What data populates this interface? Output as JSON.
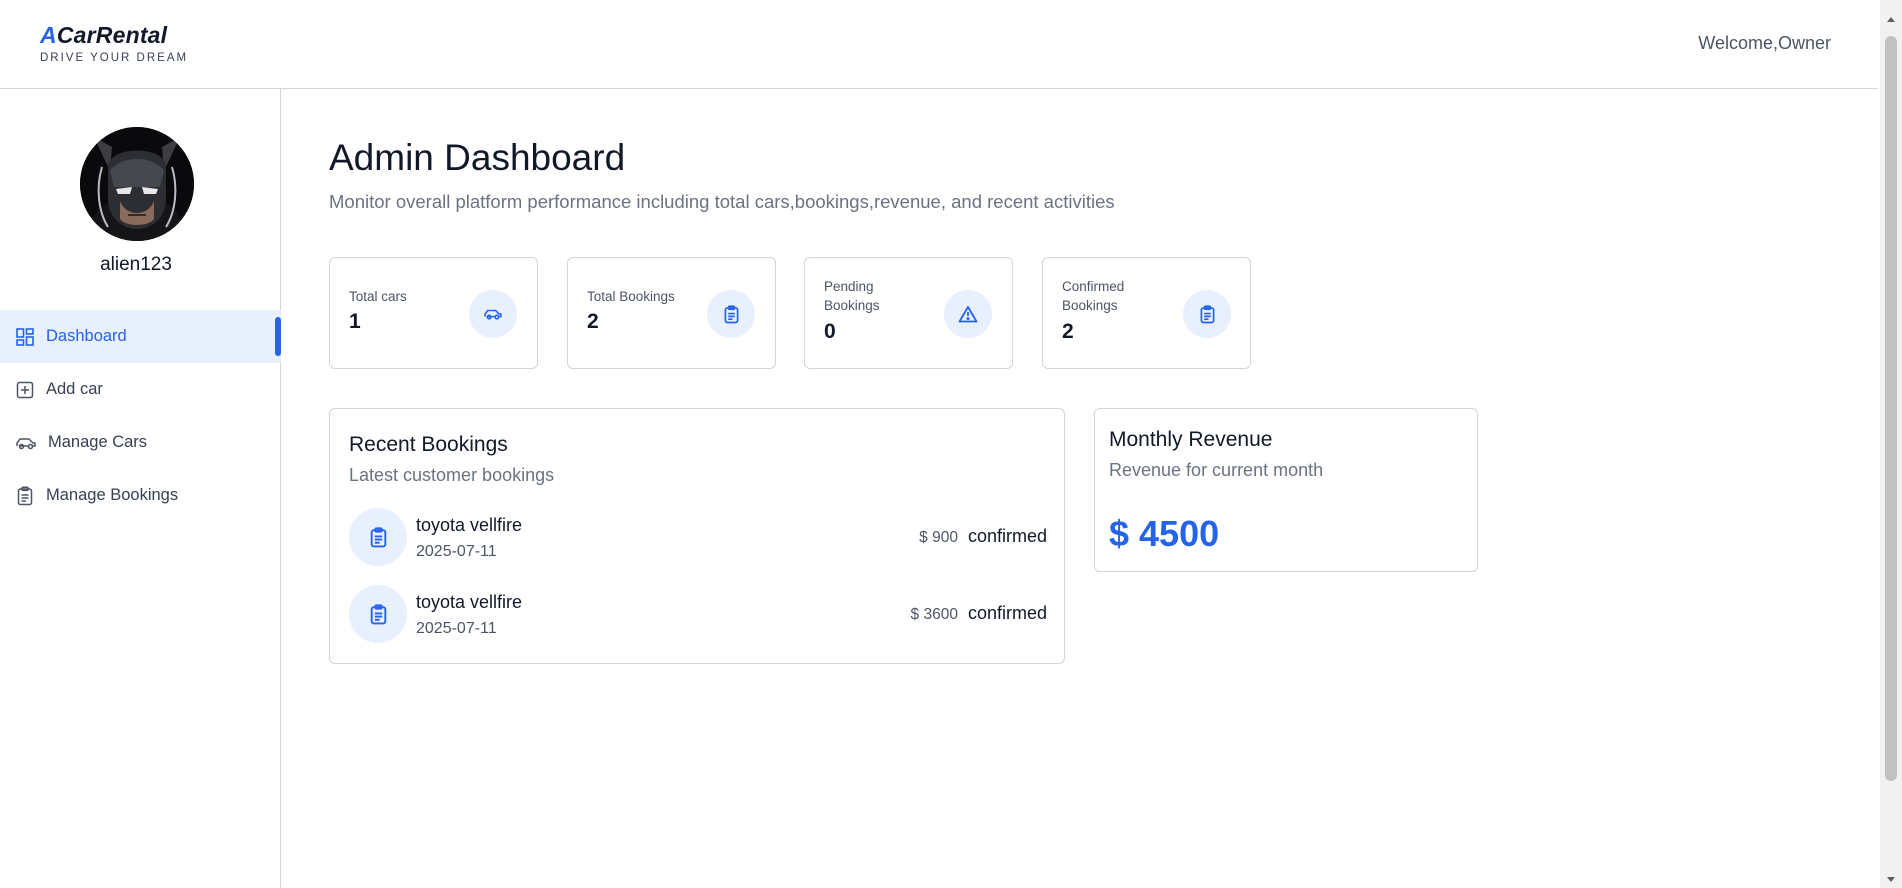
{
  "header": {
    "logo_accent": "A",
    "logo_rest": "CarRental",
    "tagline": "DRIVE YOUR DREAM",
    "welcome": "Welcome,Owner"
  },
  "sidebar": {
    "username": "alien123",
    "items": [
      {
        "label": "Dashboard",
        "icon": "dashboard-icon",
        "active": true
      },
      {
        "label": "Add car",
        "icon": "add-square-icon",
        "active": false
      },
      {
        "label": "Manage Cars",
        "icon": "car-icon",
        "active": false
      },
      {
        "label": "Manage Bookings",
        "icon": "clipboard-icon",
        "active": false
      }
    ]
  },
  "main": {
    "title": "Admin Dashboard",
    "subtitle": "Monitor overall platform performance including total cars,bookings,revenue, and recent activities",
    "stats": [
      {
        "label": "Total cars",
        "value": "1",
        "icon": "car-icon"
      },
      {
        "label": "Total Bookings",
        "value": "2",
        "icon": "clipboard-icon"
      },
      {
        "label": "Pending Bookings",
        "value": "0",
        "icon": "warning-icon"
      },
      {
        "label": "Confirmed Bookings",
        "value": "2",
        "icon": "clipboard-icon"
      }
    ],
    "recent": {
      "title": "Recent Bookings",
      "subtitle": "Latest customer bookings",
      "bookings": [
        {
          "car": "toyota vellfire",
          "date": "2025-07-11",
          "price": "$ 900",
          "status": "confirmed"
        },
        {
          "car": "toyota vellfire",
          "date": "2025-07-11",
          "price": "$ 3600",
          "status": "confirmed"
        }
      ]
    },
    "revenue": {
      "title": "Monthly Revenue",
      "subtitle": "Revenue for current month",
      "value": "$ 4500"
    }
  },
  "colors": {
    "accent": "#2563eb",
    "accent_light": "#e8effd",
    "border": "#d1d5db",
    "muted_text": "#6b7280"
  }
}
